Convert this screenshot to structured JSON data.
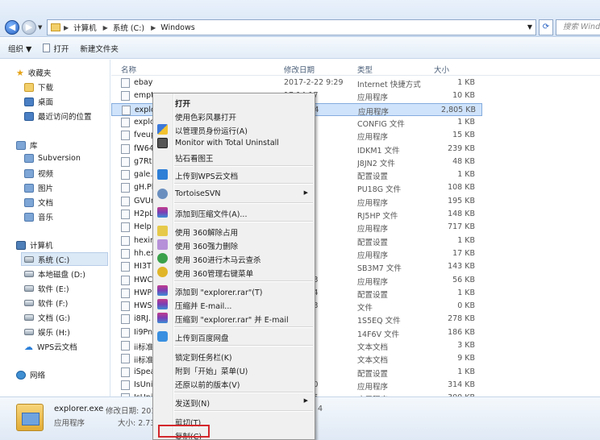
{
  "address": {
    "crumbs": [
      "计算机",
      "系统 (C:)",
      "Windows"
    ],
    "search_placeholder": "搜索 Windows"
  },
  "toolbar": {
    "organize": "组织 ▼",
    "open": "打开",
    "new_folder": "新建文件夹"
  },
  "nav": {
    "favorites": "收藏夹",
    "fav_items": [
      "下载",
      "桌面",
      "最近访问的位置"
    ],
    "libraries": "库",
    "lib_items": [
      "Subversion",
      "视频",
      "图片",
      "文档",
      "音乐"
    ],
    "computer": "计算机",
    "drives": [
      "系统 (C:)",
      "本地磁盘 (D:)",
      "软件 (E:)",
      "软件 (F:)",
      "文档 (G:)",
      "娱乐 (H:)",
      "WPS云文档"
    ],
    "network": "网络"
  },
  "columns": {
    "name": "名称",
    "date": "修改日期",
    "type": "类型",
    "size": "大小"
  },
  "files": [
    {
      "name": "ebay",
      "date": "2017-2-22 9:29",
      "type": "Internet 快捷方式",
      "size": "1 KB"
    },
    {
      "name": "empt",
      "date": "17 14:17",
      "type": "应用程序",
      "size": "10 KB"
    },
    {
      "name": "explo",
      "date": "21 11:24",
      "type": "应用程序",
      "size": "2,805 KB"
    },
    {
      "name": "explo",
      "date": "5 14:50",
      "type": "CONFIG 文件",
      "size": "1 KB"
    },
    {
      "name": "fveup",
      "date": "4 9:39",
      "type": "应用程序",
      "size": "15 KB"
    },
    {
      "name": "fW64",
      "date": "8 9:04",
      "type": "IDKM1 文件",
      "size": "239 KB"
    },
    {
      "name": "g7Rt.",
      "date": "8:16",
      "type": "J8JN2 文件",
      "size": "48 KB"
    },
    {
      "name": "gale.",
      "date": "8 13:55",
      "type": "配置设置",
      "size": "1 KB"
    },
    {
      "name": "gH.Pl",
      "date": "4 8:21",
      "type": "PU18G 文件",
      "size": "108 KB"
    },
    {
      "name": "GVUn",
      "date": "0 11:44",
      "type": "应用程序",
      "size": "195 KB"
    },
    {
      "name": "H2pL",
      "date": "5 8:18",
      "type": "RJ5HP 文件",
      "size": "148 KB"
    },
    {
      "name": "Help",
      "date": "0:14",
      "type": "应用程序",
      "size": "717 KB"
    },
    {
      "name": "hexin",
      "date": "2 8:58",
      "type": "配置设置",
      "size": "1 KB"
    },
    {
      "name": "hh.ex",
      "date": "4 9:39",
      "type": "应用程序",
      "size": "17 KB"
    },
    {
      "name": "HI3T",
      "date": "8:10",
      "type": "SB3M7 文件",
      "size": "143 KB"
    },
    {
      "name": "HWC",
      "date": "15 11:33",
      "type": "应用程序",
      "size": "56 KB"
    },
    {
      "name": "HWP",
      "date": "15 11:34",
      "type": "配置设置",
      "size": "1 KB"
    },
    {
      "name": "HWS",
      "date": "15 11:33",
      "type": "文件",
      "size": "0 KB"
    },
    {
      "name": "i8RJ.",
      "date": "3 11:03",
      "type": "1S5EQ 文件",
      "size": "278 KB"
    },
    {
      "name": "Ii9Pn",
      "date": "1 14:19",
      "type": "14F6V 文件",
      "size": "186 KB"
    },
    {
      "name": "ii标准",
      "date": "3 14:40",
      "type": "文本文档",
      "size": "3 KB"
    },
    {
      "name": "ii标准",
      "date": "3 17:10",
      "type": "文本文档",
      "size": "9 KB"
    },
    {
      "name": "iSpea",
      "date": "1 10:18",
      "type": "配置设置",
      "size": "1 KB"
    },
    {
      "name": "IsUni",
      "date": "19 12:30",
      "type": "应用程序",
      "size": "314 KB"
    },
    {
      "name": "IsUni",
      "date": "19 16:45",
      "type": "应用程序",
      "size": "300 KB"
    }
  ],
  "details": {
    "filename": "explorer.exe",
    "mod_label": "修改日期: 201",
    "type": "应用程序",
    "size_label": "大小: 2.73",
    "extra": "4"
  },
  "menu": {
    "items": [
      "打开",
      "使用色彩风暴打开",
      "以管理员身份运行(A)",
      "Monitor with Total Uninstall",
      "钻石看图王",
      "上传到WPS云文档",
      "TortoiseSVN",
      "添加到压缩文件(A)...",
      "使用 360解除占用",
      "使用 360强力删除",
      "使用 360进行木马云查杀",
      "使用 360管理右键菜单",
      "添加到 \"explorer.rar\"(T)",
      "压缩并 E-mail...",
      "压缩到 \"explorer.rar\" 并 E-mail",
      "上传到百度网盘",
      "锁定到任务栏(K)",
      "附到「开始」菜单(U)",
      "还原以前的版本(V)",
      "发送到(N)",
      "剪切(T)",
      "复制(C)"
    ]
  },
  "colors": {
    "selection": "#cfe3fb",
    "highlight_box": "#d3272b",
    "accent": "#2a63c2"
  }
}
